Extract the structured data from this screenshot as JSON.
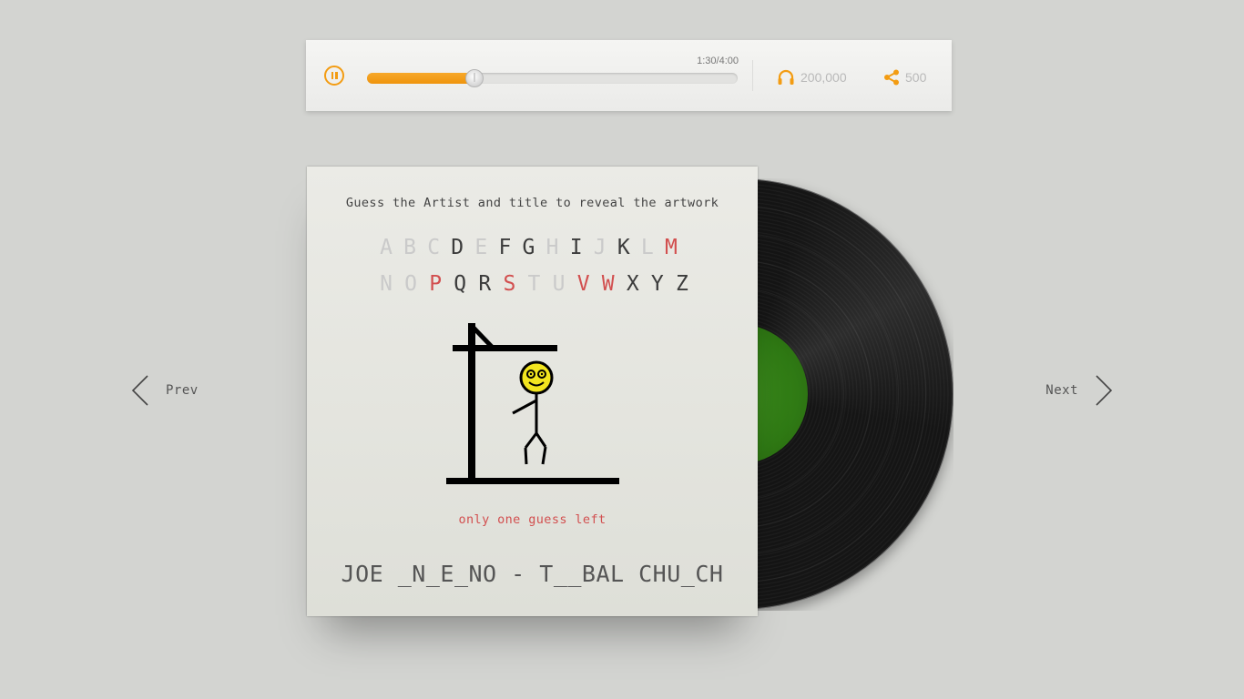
{
  "player": {
    "time": "1:30/4:00",
    "progress_fraction": 0.29,
    "listens": "200,000",
    "shares": "500",
    "accent_color": "#f39c12"
  },
  "nav": {
    "prev_label": "Prev",
    "next_label": "Next"
  },
  "game": {
    "instruction": "Guess the Artist and title to reveal the artwork",
    "letters_row1": [
      {
        "char": "A",
        "state": "used"
      },
      {
        "char": "B",
        "state": "used"
      },
      {
        "char": "C",
        "state": "used"
      },
      {
        "char": "D",
        "state": "correct"
      },
      {
        "char": "E",
        "state": "used"
      },
      {
        "char": "F",
        "state": "correct"
      },
      {
        "char": "G",
        "state": "correct"
      },
      {
        "char": "H",
        "state": "used"
      },
      {
        "char": "I",
        "state": "correct"
      },
      {
        "char": "J",
        "state": "used"
      },
      {
        "char": "K",
        "state": "correct"
      },
      {
        "char": "L",
        "state": "used"
      },
      {
        "char": "M",
        "state": "wrong"
      }
    ],
    "letters_row2": [
      {
        "char": "N",
        "state": "used"
      },
      {
        "char": "O",
        "state": "used"
      },
      {
        "char": "P",
        "state": "wrong"
      },
      {
        "char": "Q",
        "state": "correct"
      },
      {
        "char": "R",
        "state": "correct"
      },
      {
        "char": "S",
        "state": "wrong"
      },
      {
        "char": "T",
        "state": "used"
      },
      {
        "char": "U",
        "state": "used"
      },
      {
        "char": "V",
        "state": "wrong"
      },
      {
        "char": "W",
        "state": "wrong"
      },
      {
        "char": "X",
        "state": "correct"
      },
      {
        "char": "Y",
        "state": "correct"
      },
      {
        "char": "Z",
        "state": "correct"
      }
    ],
    "guesses_left": "only one guess left",
    "answer": "JOE _N_E_NO - T__BAL CHU_CH"
  }
}
